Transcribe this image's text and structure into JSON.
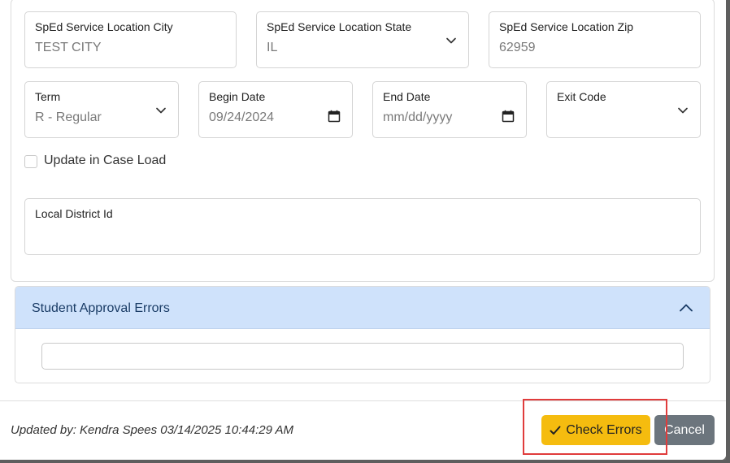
{
  "fields": {
    "city": {
      "label": "SpEd Service Location City",
      "value": "TEST CITY"
    },
    "state": {
      "label": "SpEd Service Location State",
      "value": "IL"
    },
    "zip": {
      "label": "SpEd Service Location Zip",
      "value": "62959"
    },
    "term": {
      "label": "Term",
      "value": "R - Regular"
    },
    "begin_date": {
      "label": "Begin Date",
      "value": "09/24/2024"
    },
    "end_date": {
      "label": "End Date",
      "value": "mm/dd/yyyy"
    },
    "exit_code": {
      "label": "Exit Code",
      "value": ""
    },
    "local_district": {
      "label": "Local District Id",
      "value": ""
    }
  },
  "checkbox": {
    "label": "Update in Case Load",
    "checked": false
  },
  "accordion": {
    "title": "Student Approval Errors",
    "input_value": ""
  },
  "footer": {
    "updated_text": "Updated by: Kendra Spees 03/14/2025 10:44:29 AM",
    "check_errors_label": "Check Errors",
    "cancel_label": "Cancel"
  },
  "colors": {
    "accent_button": "#f5bc0f",
    "cancel_button": "#6c757d",
    "accordion_header": "#cfe2fb",
    "highlight_box": "#e03c3c"
  },
  "icons": [
    "chevron-down-icon",
    "calendar-icon",
    "chevron-up-icon",
    "checkmark-icon"
  ]
}
